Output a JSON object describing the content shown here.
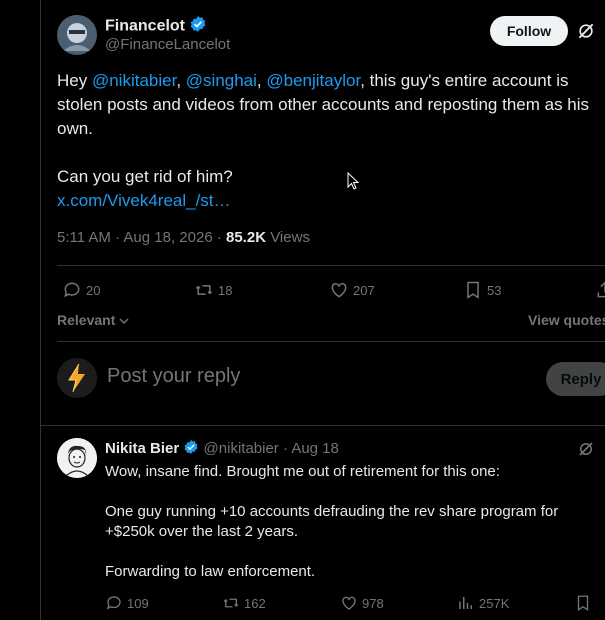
{
  "tweet": {
    "author_name": "Financelot",
    "author_handle": "@FinanceLancelot",
    "follow_label": "Follow",
    "text_hey": "Hey ",
    "mention1": "@nikitabier",
    "comma1": ", ",
    "mention2": "@singhai",
    "comma2": ", ",
    "mention3": "@benjitaylor",
    "text_line1_rest": ", this guy's entire account is",
    "text_line2": "stolen posts and videos from other accounts and reposting them as his",
    "text_line3": "own.",
    "text_line4": "Can you get rid of him?",
    "link": "x.com/Vivek4real_/st…",
    "timestamp": "5:11 AM · Aug 18, 2026 · ",
    "views_count": "85.2K",
    "views_label": " Views",
    "actions": {
      "replies": "20",
      "reposts": "18",
      "likes": "207",
      "bookmarks": "53"
    },
    "sort_label": "Relevant",
    "view_quotes_label": "View quotes"
  },
  "composer": {
    "placeholder": "Post your reply",
    "reply_label": "Reply"
  },
  "reply": {
    "author_name": "Nikita Bier",
    "author_handle": "@nikitabier",
    "date": " · Aug 18",
    "para1": "Wow, insane find.  Brought me out of retirement for this one:",
    "para2": "One guy running +10 accounts defrauding the rev share program for +$250k over the last 2 years.",
    "para3": "Forwarding to law enforcement.",
    "actions": {
      "replies": "109",
      "reposts": "162",
      "likes": "978",
      "views": "257K"
    }
  },
  "colors": {
    "accent": "#1d9bf0",
    "background": "#000000",
    "text": "#e7e9ea",
    "muted": "#71767b",
    "divider": "#2f3336"
  }
}
